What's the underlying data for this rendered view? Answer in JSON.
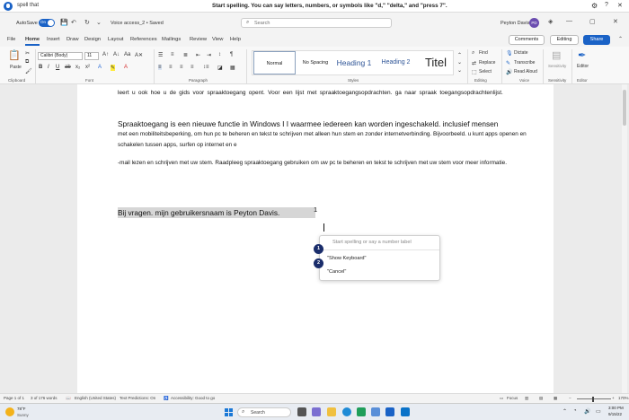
{
  "voice_bar": {
    "label": "spell that",
    "message": "Start spelling. You can say letters, numbers, or symbols like \"d,\" \"delta,\" and \"press 7\"."
  },
  "titlebar": {
    "autosave_label": "AutoSave",
    "autosave_state": "On",
    "doc_name": "Voice access_2 • Saved",
    "search_placeholder": "Search",
    "user_name": "Peyton Davis",
    "user_initials": "PD"
  },
  "menu": {
    "items": [
      "File",
      "Home",
      "Insert",
      "Draw",
      "Design",
      "Layout",
      "References",
      "Mailings",
      "Review",
      "View",
      "Help"
    ],
    "active": "Home",
    "comments": "Comments",
    "editing": "Editing",
    "share": "Share"
  },
  "ribbon": {
    "paste": "Paste",
    "font": "Calibri (Body)",
    "size": "11",
    "groups": {
      "clipboard": "Clipboard",
      "font": "Font",
      "paragraph": "Paragraph",
      "styles": "Styles",
      "editing": "Editing",
      "voice": "Voice",
      "sensitivity": "Sensitivity",
      "editor": "Editor"
    },
    "styles": [
      "Normal",
      "No Spacing",
      "Heading 1",
      "Heading 2",
      "Titel"
    ],
    "find": "Find",
    "replace": "Replace",
    "select": "Select",
    "dictate": "Dictate",
    "transcribe": "Transcribe",
    "read_aloud": "Read Aloud",
    "sensitivity": "Sensitivity",
    "editor": "Editor"
  },
  "document": {
    "para1": "leert u ook hoe u de gids voor spraaktoegang opent. Voor een lijst met spraaktoegangsopdrachten. ga naar spraak toegangsopdrachtenlijst.",
    "para2_first": "Spraaktoegang is een nieuwe functie in Windows I I waarmee iedereen kan worden ingeschakeld. inclusief mensen",
    "para2_rest": "met een mobiliteitsbeperking, om hun pc te beheren en tekst te schrijven met alleen hun stem en zonder internetverbinding. Bijvoorbeeld. u kunt apps openen en schakelen tussen apps, surfen op internet en e",
    "para3": "-mail lezen en schrijven met uw stem. Raadpleeg spraaktoegang gebruiken om uw pc te beheren en tekst te schrijven met uw stem voor meer informatie.",
    "highlight": "Bij vragen. mijn gebruikersnaam is Peyton Davis.",
    "highlight_number": "1"
  },
  "spell_popup": {
    "placeholder": "Start spelling or say a number label",
    "options": [
      {
        "num": "1",
        "label": "\"Show Keyboard\""
      },
      {
        "num": "2",
        "label": "\"Cancel\""
      }
    ]
  },
  "statusbar": {
    "page": "Page 1 of 1",
    "words": "3 of 176 words",
    "language": "English (United States)",
    "predictions": "Text Predictions: On",
    "accessibility": "Accessibility: Good to go",
    "focus": "Focus",
    "zoom": "170%"
  },
  "taskbar": {
    "temp": "78°F",
    "weather": "Sunny",
    "search": "Search",
    "time": "3:00 PM",
    "date": "9/15/22"
  },
  "colors": {
    "accent": "#1a62c6",
    "badge": "#1a2d6b",
    "highlight": "#d6d6d6"
  }
}
